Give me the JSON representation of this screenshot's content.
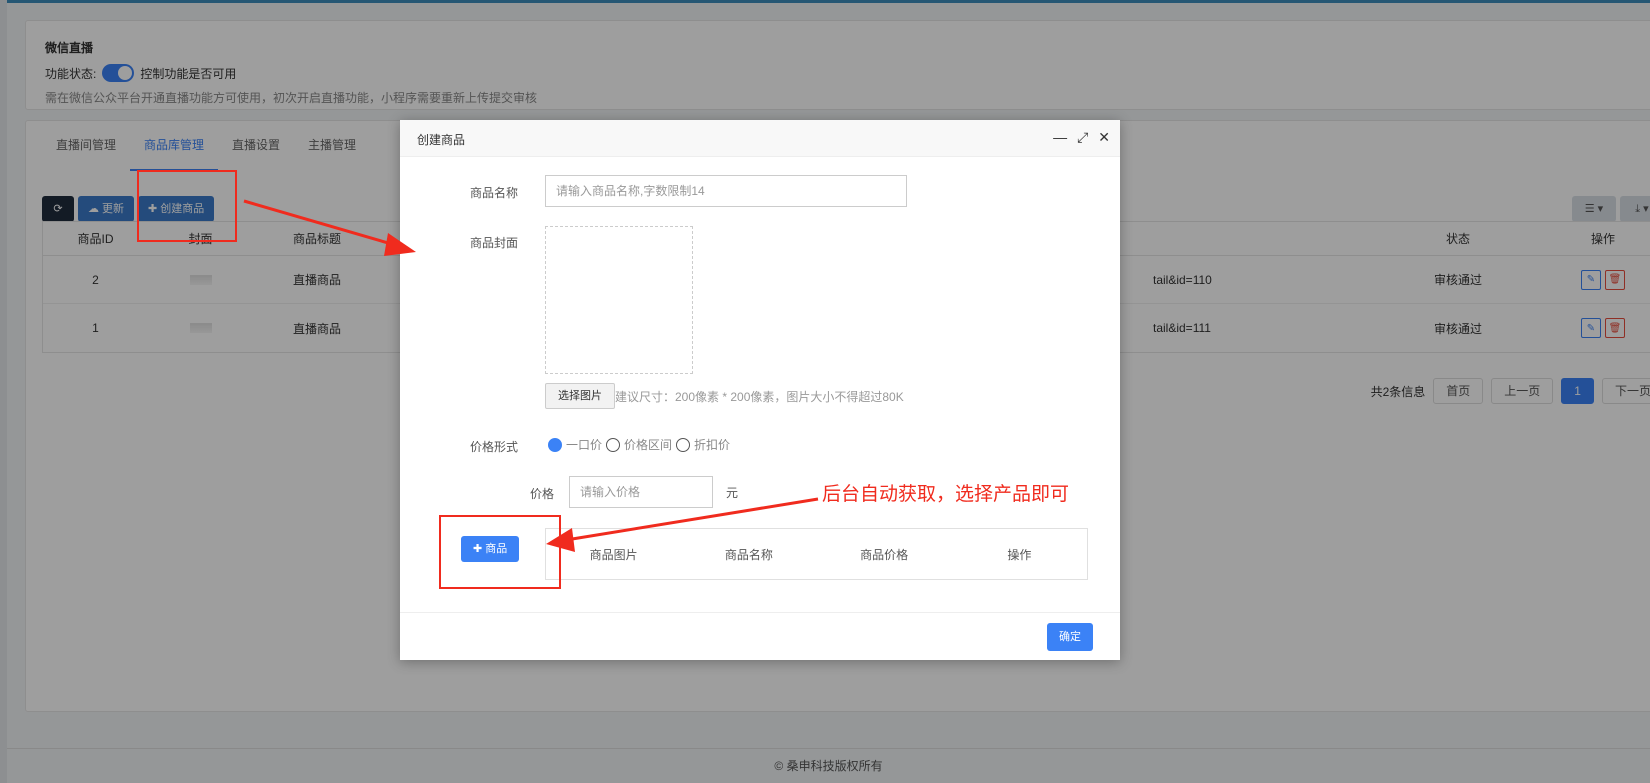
{
  "live": {
    "title": "微信直播",
    "status_label": "功能状态:",
    "switch_hint": "控制功能是否可用",
    "note": "需在微信公众平台开通直播功能方可使用，初次开启直播功能，小程序需要重新上传提交审核"
  },
  "tabs": [
    "直播间管理",
    "商品库管理",
    "直播设置",
    "主播管理"
  ],
  "toolbar": {
    "refresh_icon": "refresh-icon",
    "update_label": "更新",
    "create_label": "✚ 创建商品"
  },
  "table": {
    "headers": {
      "id": "商品ID",
      "cover": "封面",
      "title": "商品标题",
      "status": "状态",
      "op": "操作"
    },
    "rows": [
      {
        "id": "2",
        "title": "直播商品",
        "path": "tail&id=110",
        "status": "审核通过"
      },
      {
        "id": "1",
        "title": "直播商品",
        "path": "tail&id=111",
        "status": "审核通过"
      }
    ]
  },
  "pagination": {
    "total": "共2条信息",
    "first": "首页",
    "prev": "上一页",
    "current": "1",
    "next": "下一页"
  },
  "footer": "© 桑申科技版权所有",
  "modal": {
    "title": "创建商品",
    "name_label": "商品名称",
    "name_placeholder": "请输入商品名称,字数限制14",
    "cover_label": "商品封面",
    "pick_label": "选择图片",
    "pick_hint": "建议尺寸：200像素 * 200像素，图片大小不得超过80K",
    "price_type_label": "价格形式",
    "price_types": [
      "一口价",
      "价格区间",
      "折扣价"
    ],
    "price_label": "价格",
    "price_placeholder": "请输入价格",
    "unit": "元",
    "add_product_label": "✚ 商品",
    "product_headers": [
      "商品图片",
      "商品名称",
      "商品价格",
      "操作"
    ],
    "ok_label": "确定"
  },
  "annotation": "后台自动获取，选择产品即可",
  "colors": {
    "accent": "#3b82f6",
    "annotation": "#f02b1e",
    "dark_button": "#1f2d3d"
  }
}
